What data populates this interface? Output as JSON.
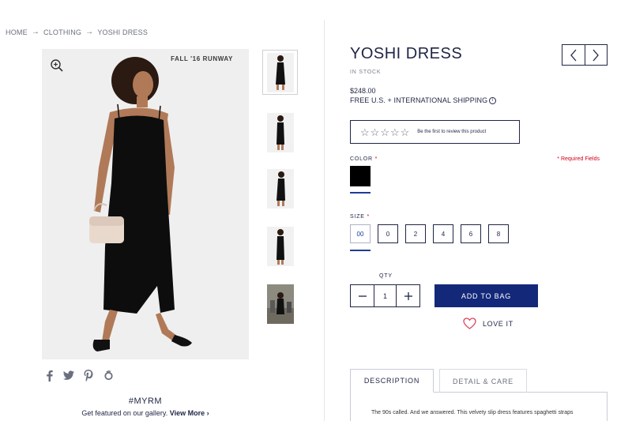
{
  "breadcrumb": {
    "items": [
      "HOME",
      "CLOTHING",
      "YOSHI DRESS"
    ],
    "separator": "→"
  },
  "gallery": {
    "badge": "FALL '16 RUNWAY",
    "zoom_icon": "zoom-in-icon",
    "thumbnail_count": 5
  },
  "social": {
    "icons": [
      "facebook-icon",
      "twitter-icon",
      "pinterest-icon",
      "tumblr-icon"
    ]
  },
  "myrm": {
    "tag": "#MYRM",
    "text": "Get featured on our gallery.",
    "link": "View More ›"
  },
  "product": {
    "title": "YOSHI DRESS",
    "stock": "IN STOCK",
    "price": "$248.00",
    "shipping": "FREE U.S. + INTERNATIONAL SHIPPING",
    "review_text": "Be the first to review this product",
    "rating_stars": 5
  },
  "options": {
    "color_label": "COLOR",
    "required_mark": "*",
    "required_note": "* Required Fields",
    "size_label": "SIZE",
    "sizes": [
      "00",
      "0",
      "2",
      "4",
      "6",
      "8"
    ],
    "selected_size": "00",
    "selected_color": "#000000"
  },
  "purchase": {
    "qty_label": "QTY",
    "qty_value": "1",
    "add_to_bag": "ADD TO BAG",
    "love_label": "LOVE IT"
  },
  "tabs": {
    "description": "DESCRIPTION",
    "detail": "DETAIL & CARE",
    "description_text": "The 90s called. And we answered. This velvety slip dress features spaghetti straps"
  },
  "colors": {
    "navy": "#1f2544",
    "button": "#14287a",
    "accent_underline": "#1f3a9a",
    "required": "#d0021b"
  }
}
